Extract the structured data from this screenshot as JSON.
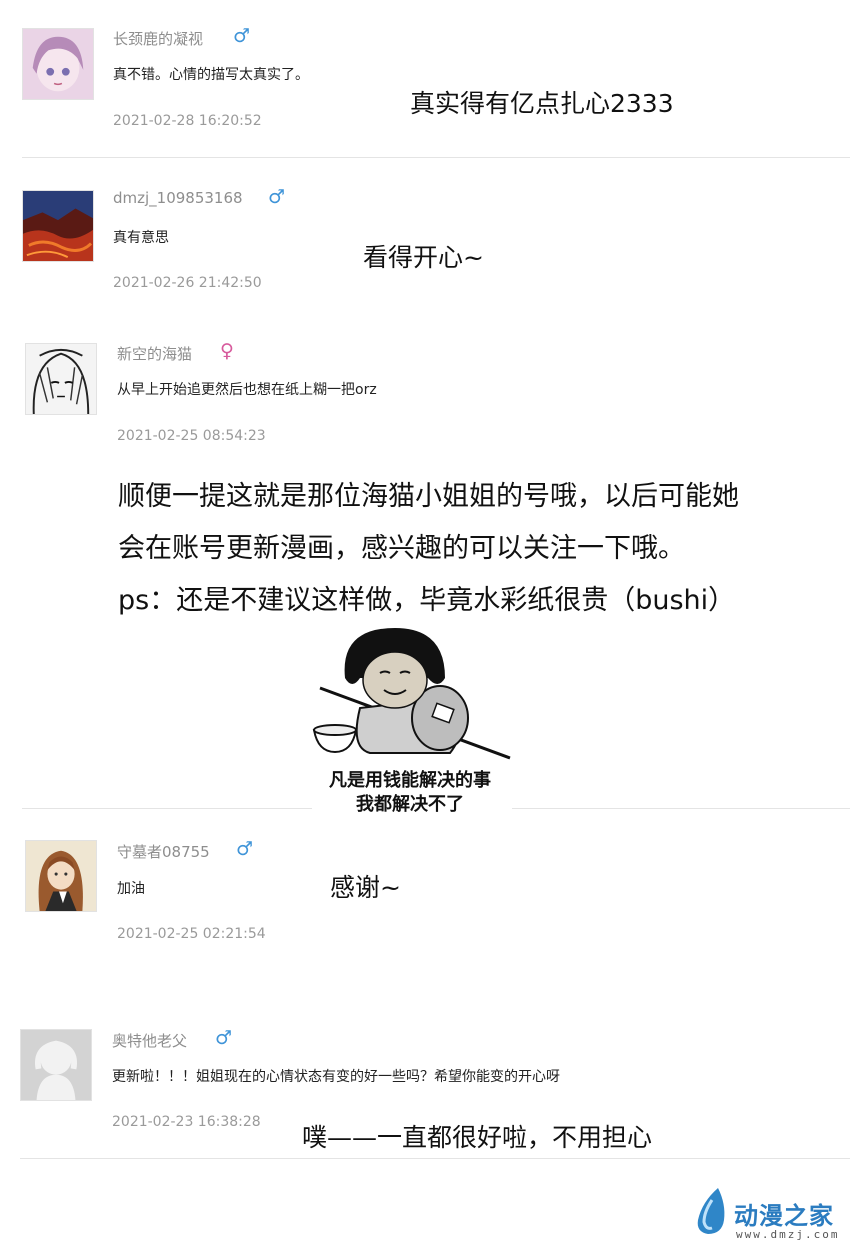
{
  "comments": [
    {
      "username": "长颈鹿的凝视",
      "gender": "male",
      "gender_icon": "♂",
      "text": "真不错。心情的描写太真实了。",
      "time": "2021-02-28 16:20:52",
      "reply": "真实得有亿点扎心2333"
    },
    {
      "username": "dmzj_109853168",
      "gender": "male",
      "gender_icon": "♂",
      "text": "真有意思",
      "time": "2021-02-26 21:42:50",
      "reply": "看得开心~"
    },
    {
      "username": "新空的海猫",
      "gender": "female",
      "gender_icon": "♀",
      "text": "从早上开始追更然后也想在纸上糊一把orz",
      "time": "2021-02-25 08:54:23",
      "reply": ""
    },
    {
      "username": "守墓者08755",
      "gender": "male",
      "gender_icon": "♂",
      "text": "加油",
      "time": "2021-02-25 02:21:54",
      "reply": "感谢~"
    },
    {
      "username": "奥特他老父",
      "gender": "male",
      "gender_icon": "♂",
      "text": "更新啦！！！姐姐现在的心情状态有变的好一些吗？希望你能变的开心呀",
      "time": "2021-02-23 16:38:28",
      "reply": "噗——一直都很好啦，不用担心"
    }
  ],
  "note": {
    "lines": [
      "顺便一提这就是那位海猫小姐姐的号哦，以后可能她",
      "会在账号更新漫画，感兴趣的可以关注一下哦。",
      "ps：还是不建议这样做，毕竟水彩纸很贵（bushi）"
    ]
  },
  "meme": {
    "caption_line1": "凡是用钱能解决的事",
    "caption_line2": "我都解决不了"
  },
  "watermark": {
    "logo_text": "动漫之家",
    "url": "www.dmzj.com"
  }
}
